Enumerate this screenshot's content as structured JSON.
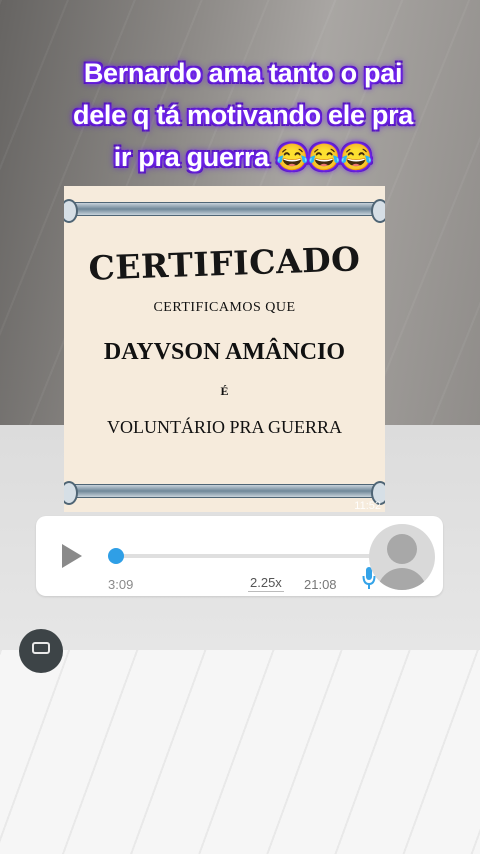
{
  "caption": {
    "line1": "Bernardo ama tanto o pai",
    "line2": "dele q tá motivando  ele pra",
    "line3_text": "ir pra guerra ",
    "line3_emojis": "😂😂😂"
  },
  "certificate": {
    "title": "CERTIFICADO",
    "line1": "CERTIFICAMOS QUE",
    "name": "DAYVSON AMÂNCIO",
    "connector": "É",
    "volunteer": "VOLUNTÁRIO PRA GUERRA",
    "timestamp": "11:52"
  },
  "audio_message": {
    "duration": "3:09",
    "speed": "2.25x",
    "time": "21:08",
    "progress": 0,
    "accent_color": "#34a3e8",
    "play_icon": "play-icon",
    "mic_icon": "mic-icon"
  },
  "colors": {
    "caption_glow": "#7b2cff",
    "bubble_bg": "#ffffff"
  }
}
